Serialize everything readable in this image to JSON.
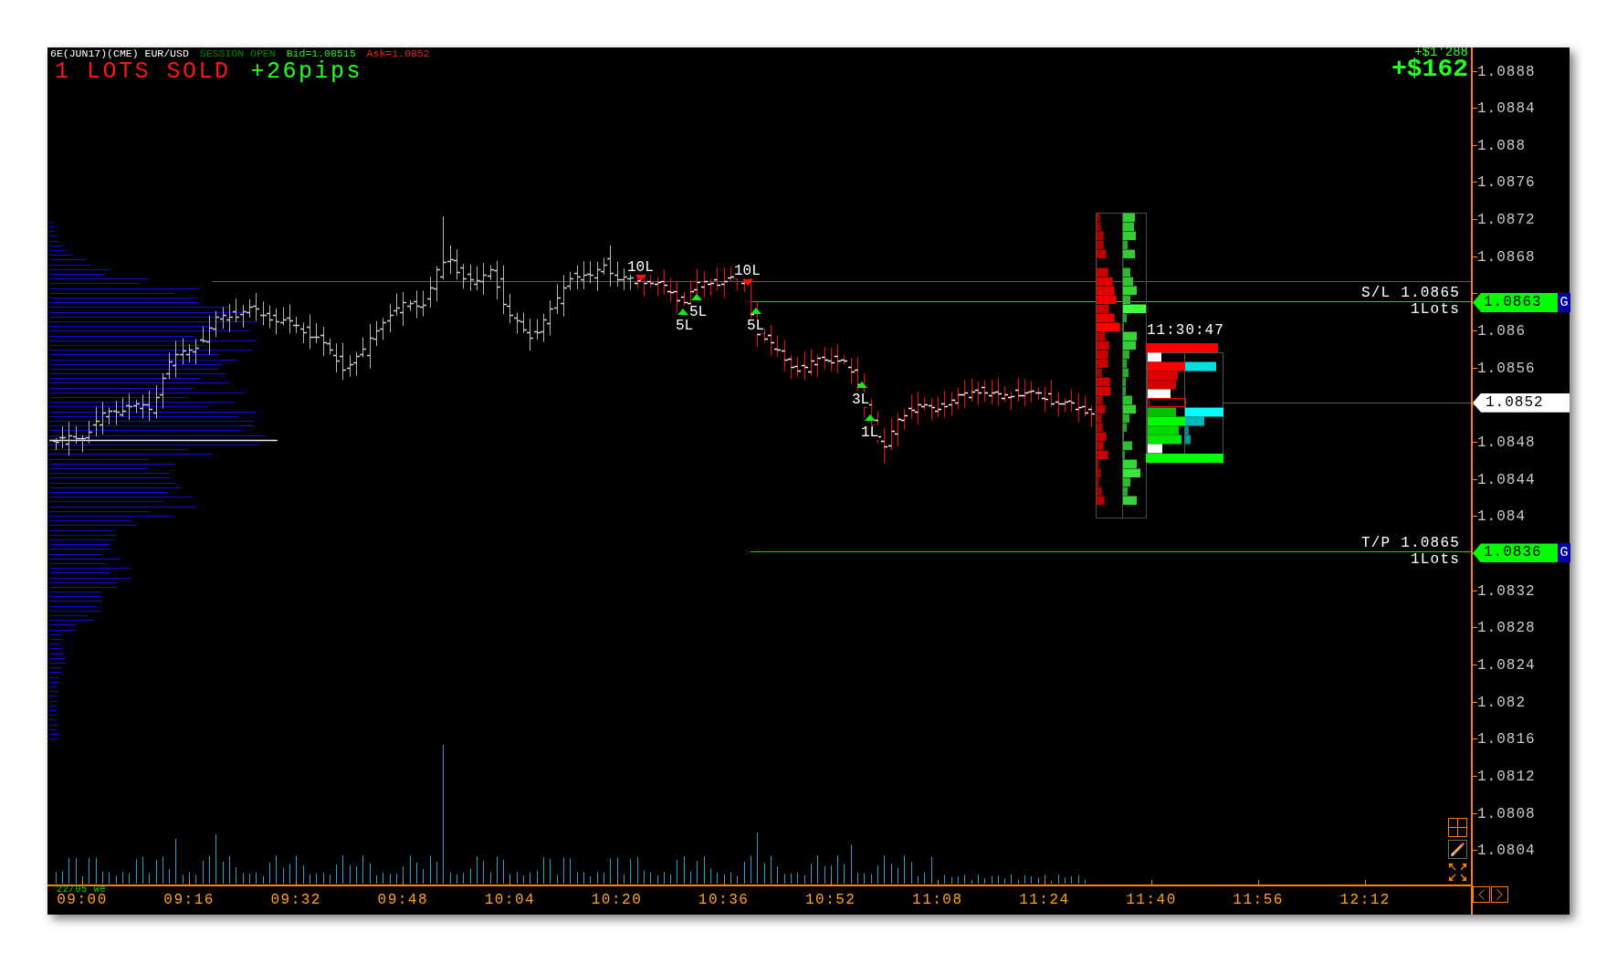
{
  "header": {
    "instrument": "6E(JUN17)(CME) EUR/USD",
    "session": "SESSION OPEN",
    "bid": "Bid=1.08515",
    "ask": "Ask=1.0852",
    "position": "1 LOTS SOLD",
    "pips": "+26pips"
  },
  "pnl": {
    "total": "+$1'288",
    "open": "+$162"
  },
  "trade_markers": [
    {
      "label": "10L",
      "kind": "sell"
    },
    {
      "label": "5L",
      "kind": "buy"
    },
    {
      "label": "5L",
      "kind": "buy"
    },
    {
      "label": "10L",
      "kind": "sell"
    },
    {
      "label": "5L",
      "kind": "buy"
    },
    {
      "label": "3L",
      "kind": "buy"
    },
    {
      "label": "1L",
      "kind": "buy"
    }
  ],
  "orders": [
    {
      "label": "S/L 1.0865",
      "lots": "1Lots",
      "price": "1.0863",
      "tag": "G"
    },
    {
      "label": "T/P 1.0865",
      "lots": "1Lots",
      "price": "1.0836",
      "tag": "G"
    }
  ],
  "bar_timer": "11:30:47",
  "price_axis": {
    "labels": [
      "1.0888",
      "1.0884",
      "1.088",
      "1.0876",
      "1.0872",
      "1.0868",
      "1.086",
      "1.0856",
      "1.0848",
      "1.0844",
      "1.084",
      "1.0832",
      "1.0828",
      "1.0824",
      "1.082",
      "1.0816",
      "1.0812",
      "1.0808",
      "1.0804"
    ],
    "last_price": "1.0852"
  },
  "time_axis": {
    "date": "22/05 We",
    "labels": [
      "09:00",
      "09:16",
      "09:32",
      "09:48",
      "10:04",
      "10:20",
      "10:36",
      "10:52",
      "11:08",
      "11:24",
      "11:40",
      "11:56",
      "12:12"
    ]
  }
}
